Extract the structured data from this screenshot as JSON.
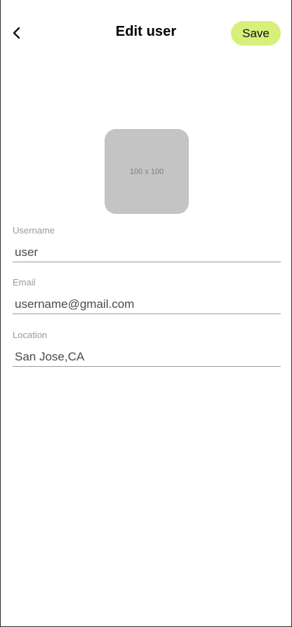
{
  "header": {
    "back_icon": "chevron-left-icon",
    "title": "Edit user",
    "save_label": "Save"
  },
  "avatar": {
    "placeholder_text": "100 x 100"
  },
  "form": {
    "username": {
      "label": "Username",
      "value": "user"
    },
    "email": {
      "label": "Email",
      "value": "username@gmail.com"
    },
    "location": {
      "label": "Location",
      "value": "San Jose,CA"
    }
  },
  "colors": {
    "accent": "#d6f07a",
    "avatar_bg": "#c4c4c4",
    "label": "#9b9b9b",
    "divider": "#9a9a9a"
  }
}
